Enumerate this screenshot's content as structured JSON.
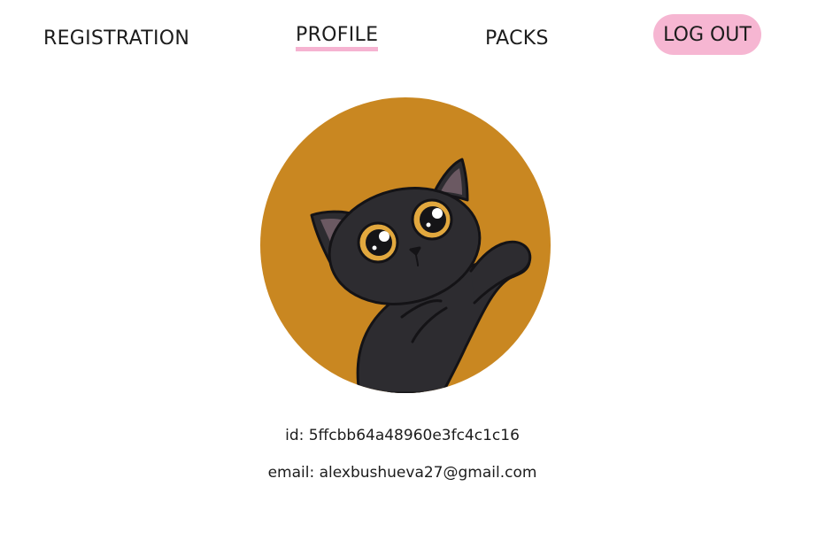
{
  "nav": {
    "registration": "REGISTRATION",
    "profile": "PROFILE",
    "packs": "PACKS",
    "logout": "LOG OUT"
  },
  "profile": {
    "avatar_icon": "black-cat-avatar",
    "id_line": "id: 5ffcbb64a48960e3fc4c1c16",
    "email_line": "email: alexbushueva27@gmail.com"
  },
  "colors": {
    "accent_pink": "#f6b6d2",
    "avatar_bg": "#c98721",
    "cat_body": "#2a292d",
    "cat_eye": "#e2a83e"
  }
}
